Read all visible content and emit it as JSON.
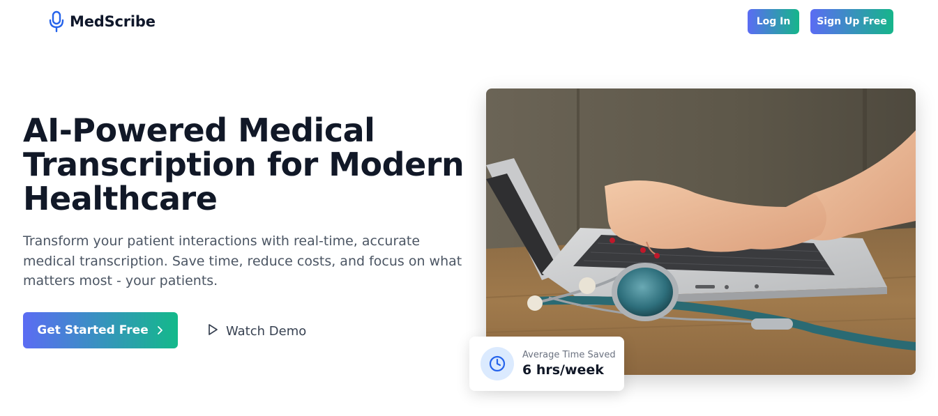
{
  "header": {
    "brand": "MedScribe",
    "logo_icon": "microphone-icon",
    "login_label": "Log In",
    "signup_label": "Sign Up Free"
  },
  "hero": {
    "title": "AI-Powered Medical Transcription for Modern Healthcare",
    "subtitle": "Transform your patient interactions with real-time, accurate medical transcription. Save time, reduce costs, and focus on what matters most - your patients.",
    "cta_primary_label": "Get Started Free",
    "cta_primary_icon": "chevron-right-icon",
    "cta_secondary_label": "Watch Demo",
    "cta_secondary_icon": "play-icon"
  },
  "stat_card": {
    "icon": "clock-icon",
    "label": "Average Time Saved",
    "value": "6 hrs/week"
  },
  "colors": {
    "gradient_start": "#5b6cf3",
    "gradient_end": "#16b58a",
    "accent_blue": "#2563eb",
    "icon_bg": "#dbeafe",
    "text_dark": "#111827",
    "text_muted": "#4b5563"
  }
}
